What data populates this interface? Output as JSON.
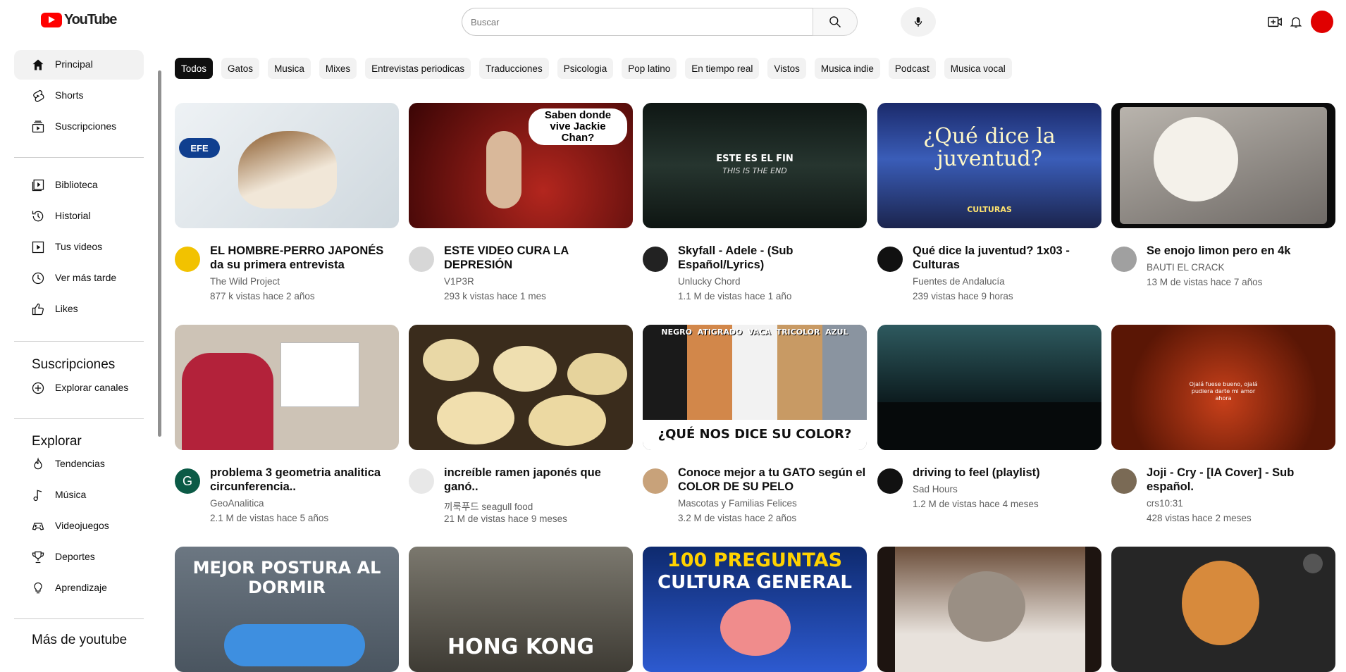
{
  "header": {
    "logo_text": "YouTube",
    "search_placeholder": "Buscar"
  },
  "sidebar": {
    "main": [
      {
        "label": "Principal",
        "icon": "home-icon",
        "active": true
      },
      {
        "label": "Shorts",
        "icon": "shorts-icon"
      },
      {
        "label": "Suscripciones",
        "icon": "subscriptions-icon"
      }
    ],
    "library": [
      {
        "label": "Biblioteca",
        "icon": "library-icon"
      },
      {
        "label": "Historial",
        "icon": "history-icon"
      },
      {
        "label": "Tus videos",
        "icon": "your-videos-icon"
      },
      {
        "label": "Ver más tarde",
        "icon": "watch-later-icon"
      },
      {
        "label": "Likes",
        "icon": "like-icon"
      }
    ],
    "subscriptions_title": "Suscripciones",
    "explore_channels": "Explorar canales",
    "explore_title": "Explorar",
    "explore": [
      {
        "label": "Tendencias",
        "icon": "trending-icon"
      },
      {
        "label": "Música",
        "icon": "music-icon"
      },
      {
        "label": "Videojuegos",
        "icon": "gaming-icon"
      },
      {
        "label": "Deportes",
        "icon": "sports-icon"
      },
      {
        "label": "Aprendizaje",
        "icon": "learning-icon"
      }
    ],
    "more_title": "Más de youtube"
  },
  "chips": [
    "Todos",
    "Gatos",
    "Musica",
    "Mixes",
    "Entrevistas periodicas",
    "Traducciones",
    "Psicologia",
    "Pop latino",
    "En tiempo real",
    "Vistos",
    "Musica indie",
    "Podcast",
    "Musica vocal"
  ],
  "videos": [
    {
      "title": "EL HOMBRE-PERRO JAPONÉS da su primera entrevista",
      "channel": "The Wild Project",
      "meta": "877 k vistas hace 2 años",
      "thumb_text": "EFE",
      "thumb_color": "#dfe5ea",
      "avatar_color": "#f2c200"
    },
    {
      "title": "ESTE VIDEO CURA LA DEPRESIÓN",
      "channel": "V1P3R",
      "meta": "293 k vistas hace 1 mes",
      "thumb_text": "Saben donde vive Jackie Chan?",
      "thumb_color": "#7a0c0c",
      "avatar_color": "#d7d7d7"
    },
    {
      "title": "Skyfall - Adele - (Sub Español/Lyrics)",
      "channel": "Unlucky Chord",
      "meta": "1.1 M de vistas hace 1 año",
      "thumb_text": "ESTE ES EL FIN",
      "thumb_sub": "THIS IS THE END",
      "thumb_color": "#1d2a26",
      "avatar_color": "#222222"
    },
    {
      "title": "Qué dice la juventud? 1x03 - Culturas",
      "channel": "Fuentes de Andalucía",
      "meta": "239 vistas hace 9 horas",
      "thumb_text": "¿Qué dice la juventud?",
      "thumb_sub": "CULTURAS",
      "thumb_color": "#1f2f6a",
      "avatar_color": "#111111"
    },
    {
      "title": "Se enojo limon pero en 4k",
      "channel": "BAUTI EL CRACK",
      "meta": "13 M de vistas hace 7 años",
      "thumb_text": "",
      "thumb_color": "#9a9a9a",
      "avatar_color": "#a0a0a0"
    },
    {
      "title": "problema 3 geometria analitica circunferencia..",
      "channel": "GeoAnalitica",
      "meta": "2.1 M de vistas hace 5 años",
      "thumb_text": "",
      "thumb_color": "#c9bfb3",
      "avatar_color": "#0b5a46",
      "avatar_letter": "G"
    },
    {
      "title": "increíble ramen japonés que ganó..",
      "channel": "끼룩푸드 seagull food",
      "meta": "21 M de vistas hace 9 meses",
      "thumb_text": "",
      "thumb_color": "#8b6a3a",
      "avatar_color": "#e8e8e8"
    },
    {
      "title": "Conoce mejor a tu GATO según el COLOR DE SU PELO",
      "channel": "Mascotas y Familias Felices",
      "meta": "3.2 M de vistas hace 2 años",
      "thumb_text": "¿QUÉ NOS DICE SU COLOR?",
      "thumb_labels": "NEGRO  ATIGRADO  VACA  TRICOLOR  AZUL",
      "thumb_color": "#3a3a3a",
      "avatar_color": "#c8a27a"
    },
    {
      "title": "driving to feel (playlist)",
      "channel": "Sad Hours",
      "meta": "1.2 M de vistas hace 4 meses",
      "thumb_text": "",
      "thumb_color": "#1f3b3f",
      "avatar_color": "#111111"
    },
    {
      "title": "Joji - Cry - [IA Cover] - Sub español.",
      "channel": "crs10:31",
      "meta": "428 vistas hace 2 meses",
      "thumb_text": "Ojalá fuese bueno, ojalá pudiera darte mi amor ahora",
      "thumb_color": "#6e1e0a",
      "avatar_color": "#7a6a55"
    },
    {
      "title": "",
      "channel": "",
      "meta": "",
      "thumb_text": "MEJOR POSTURA AL DORMIR",
      "thumb_color": "#5a6470"
    },
    {
      "title": "",
      "channel": "",
      "meta": "",
      "thumb_text": "HONG KONG",
      "thumb_color": "#5e5a4e"
    },
    {
      "title": "",
      "channel": "",
      "meta": "",
      "thumb_text": "100 PREGUNTAS",
      "thumb_sub": "CULTURA GENERAL",
      "thumb_color": "#1a3a8a"
    },
    {
      "title": "",
      "channel": "",
      "meta": "",
      "thumb_text": "",
      "thumb_color": "#3a2a20"
    },
    {
      "title": "",
      "channel": "",
      "meta": "",
      "thumb_text": "",
      "thumb_color": "#222222"
    }
  ]
}
